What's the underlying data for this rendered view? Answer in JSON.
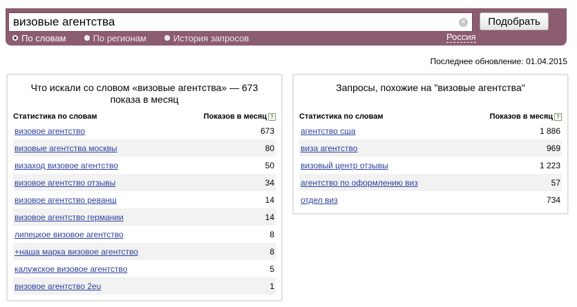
{
  "search": {
    "value": "визовые агентства",
    "clear_icon": "×",
    "submit_label": "Подобрать"
  },
  "modes": [
    {
      "label": "По словам",
      "active": true
    },
    {
      "label": "По регионам",
      "active": false
    },
    {
      "label": "История запросов",
      "active": false
    }
  ],
  "region": "Россия",
  "last_update": "Последнее обновление: 01.04.2015",
  "left_panel": {
    "title": "Что искали со словом «визовые агентства» — 673 показа в месяц",
    "col_word": "Статистика по словам",
    "col_count": "Показов в месяц",
    "help": "?",
    "rows": [
      {
        "phrase": "визовое агентство",
        "count": "673"
      },
      {
        "phrase": "визовые агентства москвы",
        "count": "80"
      },
      {
        "phrase": "визаход визовое агентство",
        "count": "50"
      },
      {
        "phrase": "визовое агентство отзывы",
        "count": "34"
      },
      {
        "phrase": "визовое агентство реванш",
        "count": "14"
      },
      {
        "phrase": "визовое агентство германии",
        "count": "14"
      },
      {
        "phrase": "липецкое визовое агентство",
        "count": "8"
      },
      {
        "phrase": "+наша марка визовое агентство",
        "count": "8"
      },
      {
        "phrase": "калужское визовое агентство",
        "count": "5"
      },
      {
        "phrase": "визовое агентство 2eu",
        "count": "1"
      }
    ]
  },
  "right_panel": {
    "title": "Запросы, похожие на \"визовые агентства\"",
    "col_word": "Статистика по словам",
    "col_count": "Показов в месяц",
    "help": "?",
    "rows": [
      {
        "phrase": "агентство сша",
        "count": "1 886"
      },
      {
        "phrase": "виза агентство",
        "count": "969"
      },
      {
        "phrase": "визовый центр отзывы",
        "count": "1 223"
      },
      {
        "phrase": "агентство по оформлению виз",
        "count": "57"
      },
      {
        "phrase": "отдел виз",
        "count": "734"
      }
    ]
  }
}
